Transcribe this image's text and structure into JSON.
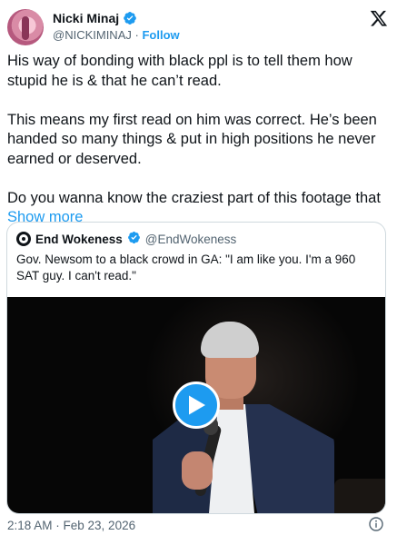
{
  "tweet": {
    "author_name": "Nicki Minaj",
    "handle": "@NICKIMINAJ",
    "separator": "·",
    "follow_label": "Follow",
    "paragraphs": [
      "His way of bonding with black ppl is to tell them how stupid he is & that he can’t read.",
      "This means my first read on him was correct. He’s been handed so many things & put in high positions he never earned or deserved.",
      "Do you wanna know the craziest part of this footage that"
    ],
    "show_more_label": "Show more",
    "timestamp": "2:18 AM · Feb 23, 2026",
    "accent_color": "#1d9bf0"
  },
  "quote": {
    "author_name": "End Wokeness",
    "handle": "@EndWokeness",
    "text": "Gov. Newsom to a black crowd in GA: \"I am like you. I'm a 960 SAT guy. I can't read.\""
  },
  "icons": {
    "brand": "x-logo-icon",
    "verified": "verified-badge-icon",
    "play": "play-icon",
    "info": "info-icon"
  }
}
